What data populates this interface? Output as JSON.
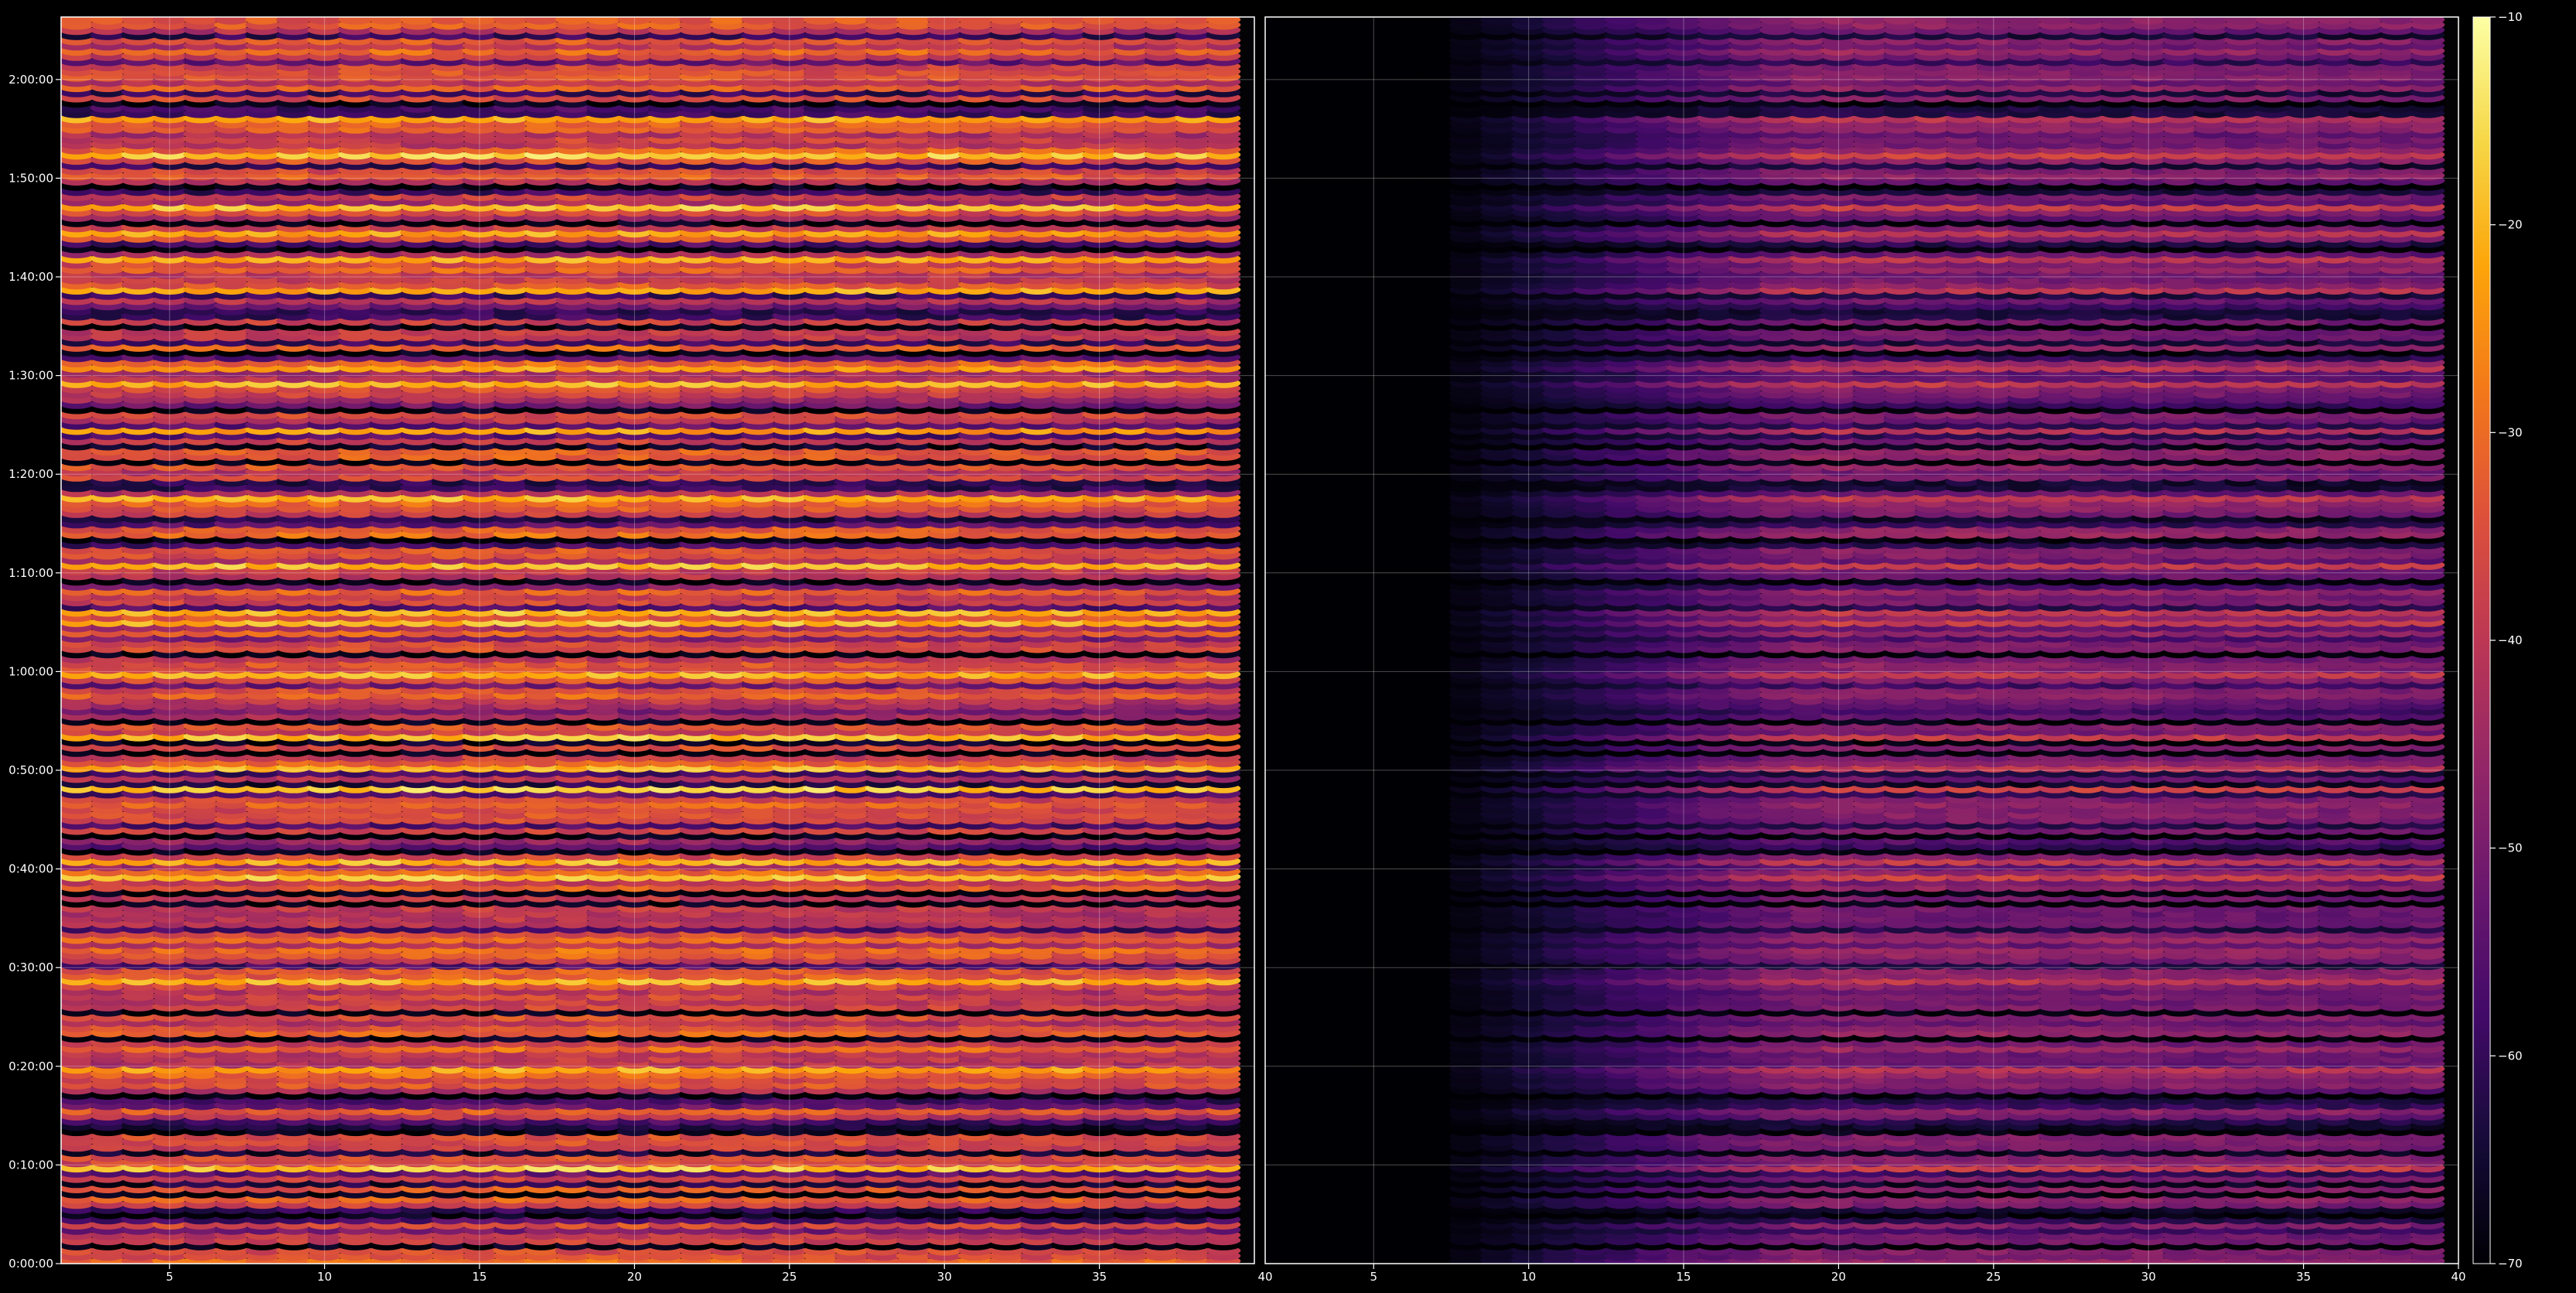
{
  "chart_data": [
    {
      "type": "heatmap",
      "panel": "left",
      "x_range": [
        1.5,
        40
      ],
      "y_range_seconds": [
        0,
        7580
      ],
      "xticks": [
        5,
        10,
        15,
        20,
        25,
        30,
        35
      ],
      "xtick_labels": [
        "5",
        "10",
        "15",
        "20",
        "25",
        "30",
        "35"
      ],
      "yticks": [
        0,
        600,
        1200,
        1800,
        2400,
        3000,
        3600,
        4200,
        4800,
        5400,
        6000,
        6600,
        7200
      ],
      "ytick_labels": [
        "0:00:00",
        "0:10:00",
        "0:20:00",
        "0:30:00",
        "0:40:00",
        "0:50:00",
        "1:00:00",
        "1:10:00",
        "1:20:00",
        "1:30:00",
        "1:40:00",
        "1:50:00",
        "2:00:00"
      ],
      "grid": true,
      "colormap": "inferno",
      "value_range": [
        -70,
        -10
      ],
      "notable_bright_bands_seconds": [
        570,
        1200,
        1715,
        2340,
        2440,
        2890,
        3030,
        3125,
        3215,
        3600,
        3900,
        3950,
        4260,
        4650,
        5060,
        5340,
        5440,
        5930,
        6115,
        6260,
        6420,
        6750,
        6960
      ],
      "dark_bands_seconds": [
        95,
        315,
        420,
        790,
        1030,
        1370,
        1520,
        2180,
        2265,
        2510,
        2615,
        3100,
        3310,
        3720,
        4150,
        4420,
        4870,
        5185,
        5555,
        5710,
        6170,
        6330,
        6560,
        7045
      ]
    },
    {
      "type": "heatmap",
      "panel": "right",
      "x_range": [
        1.5,
        40
      ],
      "y_range_seconds": [
        0,
        7580
      ],
      "xticks": [
        5,
        10,
        15,
        20,
        25,
        30,
        35,
        40
      ],
      "xtick_labels": [
        "5",
        "10",
        "15",
        "20",
        "25",
        "30",
        "35",
        "40"
      ],
      "grid": true,
      "colormap": "inferno",
      "value_range": [
        -70,
        -10
      ],
      "note": "same band structure as left panel, attenuated; near-silent for x below ~8"
    }
  ],
  "colorbar": {
    "range": [
      -70,
      -10
    ],
    "ticks": [
      -10,
      -20,
      -30,
      -40,
      -50,
      -60,
      -70
    ],
    "tick_labels": [
      "−10",
      "−20",
      "−30",
      "−40",
      "−50",
      "−60",
      "−70"
    ]
  },
  "divider_label": "40"
}
